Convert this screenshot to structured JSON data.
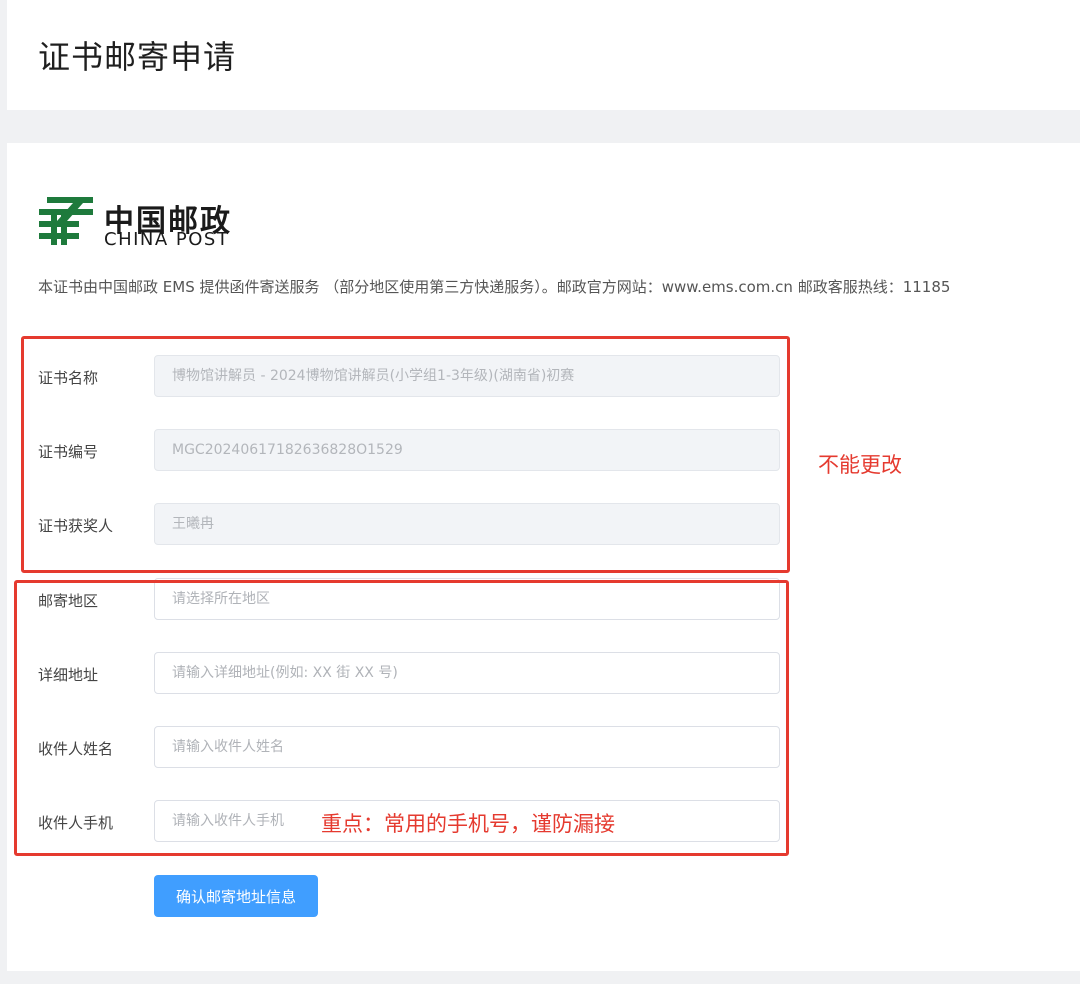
{
  "page": {
    "title": "证书邮寄申请"
  },
  "logo": {
    "name_cn": "中国邮政",
    "name_en": "CHINA POST",
    "brand_color": "#1e7a3c"
  },
  "intro": "本证书由中国邮政 EMS 提供函件寄送服务 （部分地区使用第三方快递服务）。邮政官方网站：www.ems.com.cn 邮政客服热线：11185",
  "fields": {
    "cert_name": {
      "label": "证书名称",
      "value": "博物馆讲解员 - 2024博物馆讲解员(小学组1-3年级)(湖南省)初赛"
    },
    "cert_no": {
      "label": "证书编号",
      "value": "MGC20240617182636828O1529"
    },
    "cert_holder": {
      "label": "证书获奖人",
      "value": "王曦冉"
    },
    "region": {
      "label": "邮寄地区",
      "placeholder": "请选择所在地区"
    },
    "address": {
      "label": "详细地址",
      "placeholder": "请输入详细地址(例如: XX 街 XX 号)"
    },
    "recipient": {
      "label": "收件人姓名",
      "placeholder": "请输入收件人姓名"
    },
    "phone": {
      "label": "收件人手机",
      "placeholder": "请输入收件人手机"
    }
  },
  "annotations": {
    "locked_note": "不能更改",
    "phone_note": "重点：常用的手机号，谨防漏接",
    "color": "#e53a2f"
  },
  "submit": {
    "label": "确认邮寄地址信息",
    "color": "#409eff"
  }
}
